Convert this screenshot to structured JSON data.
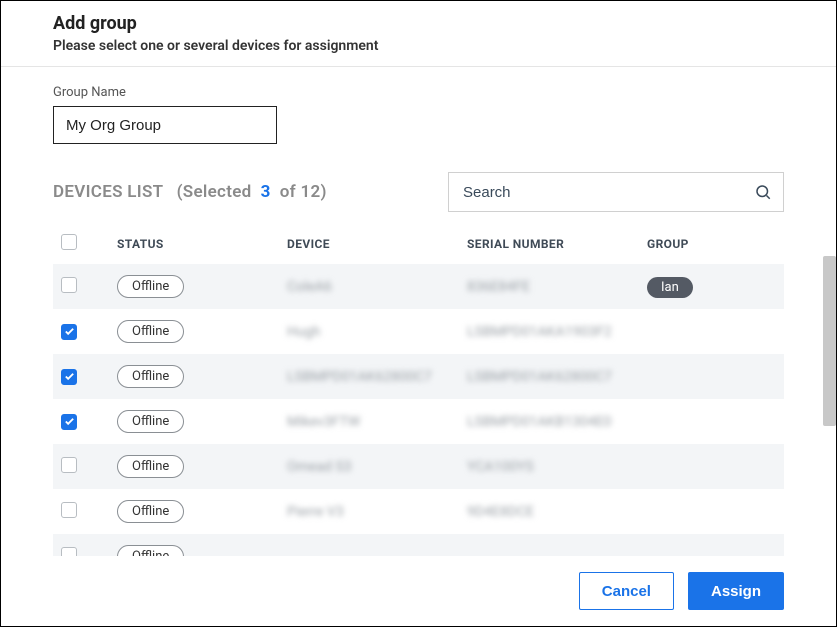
{
  "header": {
    "title": "Add group",
    "subtitle": "Please select one or several devices for assignment"
  },
  "form": {
    "group_name_label": "Group Name",
    "group_name_value": "My Org Group"
  },
  "list": {
    "title_prefix": "DEVICES LIST",
    "selected_label_open": "(Selected",
    "selected_count": "3",
    "selected_label_close": "of 12)"
  },
  "search": {
    "placeholder": "Search"
  },
  "columns": {
    "status": "STATUS",
    "device": "DEVICE",
    "serial": "SERIAL NUMBER",
    "group": "GROUP"
  },
  "rows": [
    {
      "checked": false,
      "status": "Offline",
      "device": "ColeA6",
      "serial": "836E84FE",
      "group": "Ian"
    },
    {
      "checked": true,
      "status": "Offline",
      "device": "Hugh",
      "serial": "LSBMPD01AKA1903F2",
      "group": ""
    },
    {
      "checked": true,
      "status": "Offline",
      "device": "LSBMPD01AK62800C7",
      "serial": "LSBMPD01AK62800C7",
      "group": ""
    },
    {
      "checked": true,
      "status": "Offline",
      "device": "Mikev3FTW",
      "serial": "LSBMPD01AKB1304E0",
      "group": ""
    },
    {
      "checked": false,
      "status": "Offline",
      "device": "Omead S3",
      "serial": "YCA100YS",
      "group": ""
    },
    {
      "checked": false,
      "status": "Offline",
      "device": "Pierre V3",
      "serial": "9D4E8DCE",
      "group": ""
    },
    {
      "checked": false,
      "status": "Offline",
      "device": "",
      "serial": "",
      "group": ""
    }
  ],
  "footer": {
    "cancel": "Cancel",
    "assign": "Assign"
  }
}
